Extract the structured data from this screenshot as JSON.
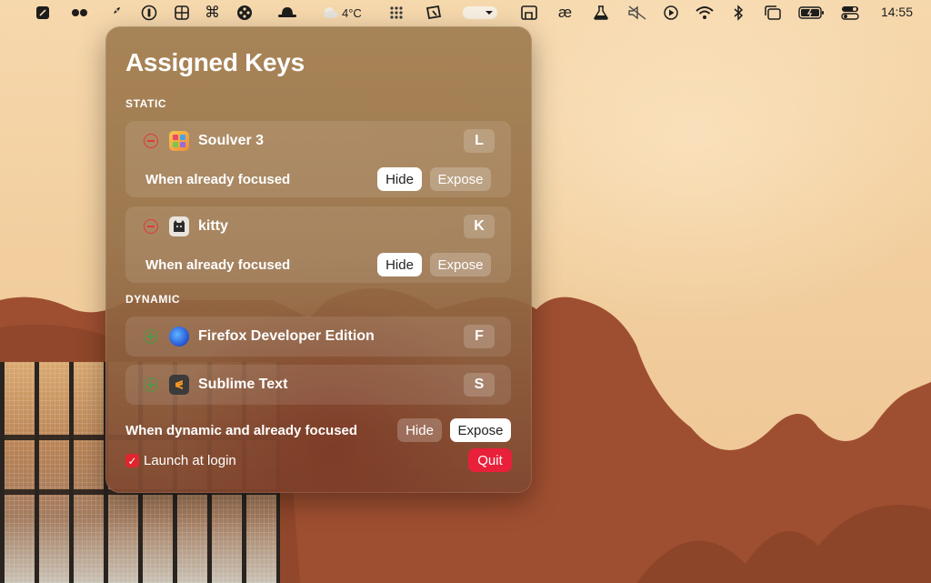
{
  "menubar": {
    "weather_temp": "4°C",
    "clock": "14:55",
    "icons": [
      "notes-icon",
      "dots-icon",
      "rocket-icon",
      "one-password-icon",
      "calculator-grid-icon",
      "command-icon",
      "film-reel-icon",
      "bowler-hat-icon",
      "weather-icon",
      "grid-dots-icon",
      "cursor-box-icon",
      "toggle-icon",
      "resize-icon",
      "ae-icon",
      "flask-icon",
      "mute-icon",
      "play-icon",
      "wifi-icon",
      "bluetooth-icon",
      "window-icon",
      "battery-icon",
      "control-center-icon"
    ]
  },
  "panel": {
    "title": "Assigned Keys",
    "static_label": "STATIC",
    "dynamic_label": "DYNAMIC",
    "static_items": [
      {
        "name": "Soulver 3",
        "key": "L",
        "focus_label": "When already focused",
        "hide_label": "Hide",
        "expose_label": "Expose",
        "icon": "soulver-icon"
      },
      {
        "name": "kitty",
        "key": "K",
        "focus_label": "When already focused",
        "hide_label": "Hide",
        "expose_label": "Expose",
        "icon": "kitty-icon"
      }
    ],
    "dynamic_items": [
      {
        "name": "Firefox Developer Edition",
        "key": "F",
        "icon": "firefox-icon"
      },
      {
        "name": "Sublime Text",
        "key": "S",
        "icon": "sublime-icon"
      }
    ],
    "dynamic_focus_label": "When dynamic and already focused",
    "dynamic_hide_label": "Hide",
    "dynamic_expose_label": "Expose",
    "launch_label": "Launch at login",
    "launch_checked": true,
    "quit_label": "Quit"
  },
  "colors": {
    "accent_red": "#e8203a",
    "remove_red": "#e0373a",
    "add_green": "#4d9a4a"
  }
}
